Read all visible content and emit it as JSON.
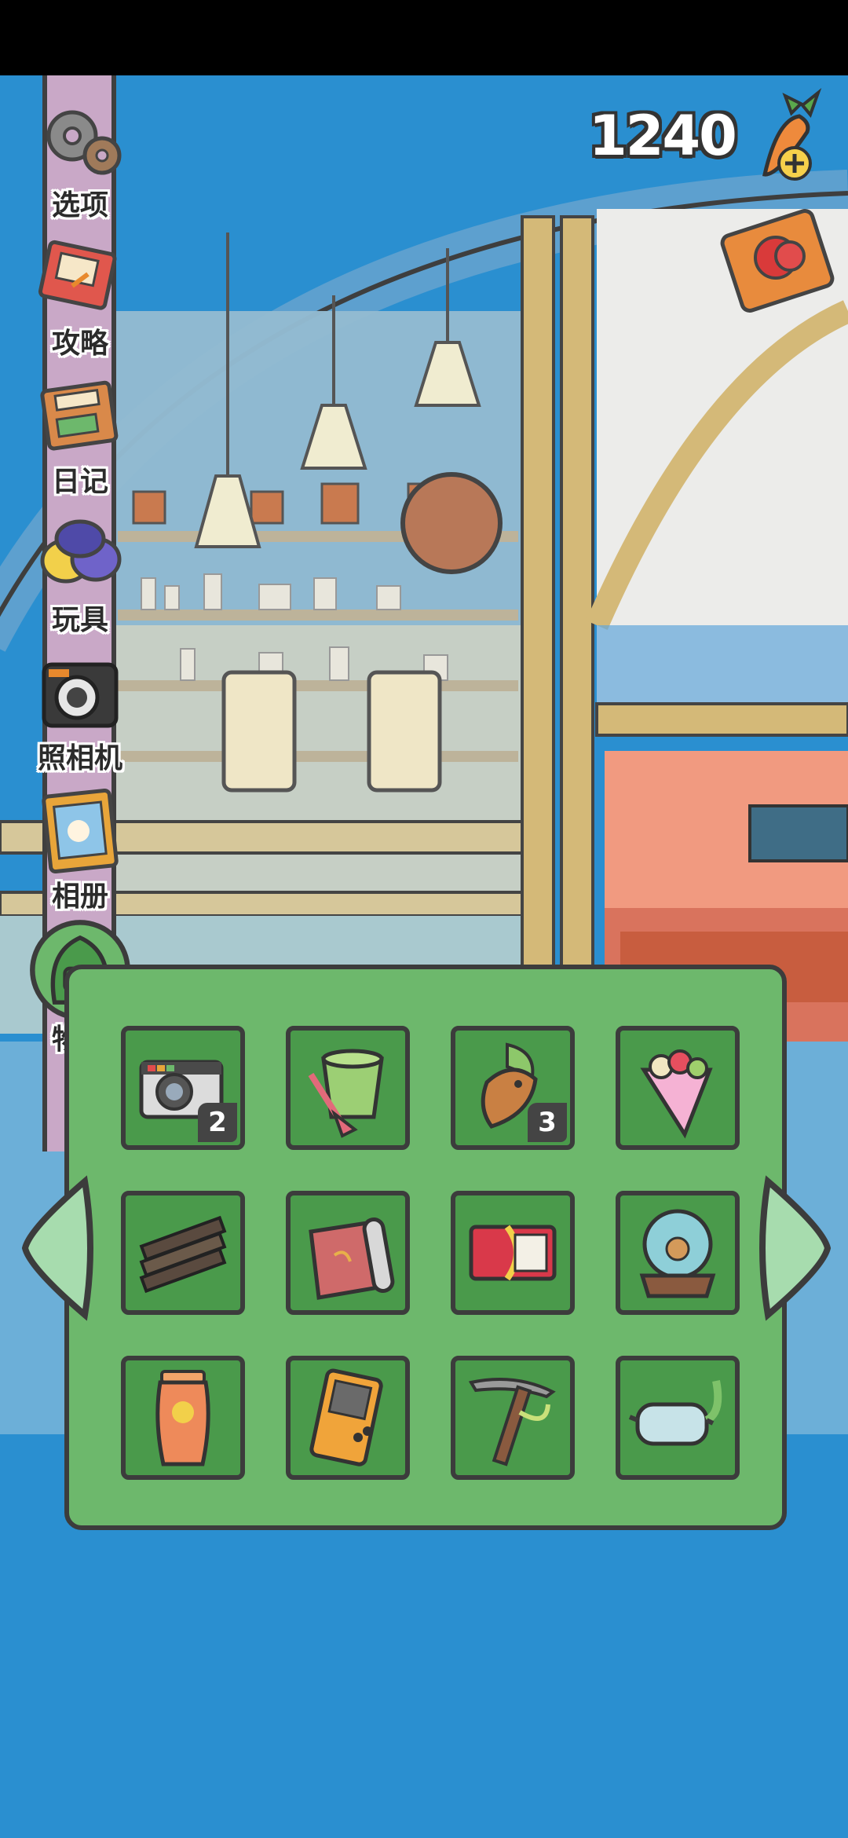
{
  "status_bar": {},
  "header": {
    "currency_value": "1240",
    "currency_icon": "carrot-plus-icon",
    "ticket_icon": "ticket-icon"
  },
  "side_menu": {
    "items": [
      {
        "label": "选项",
        "icon": "gear-icon"
      },
      {
        "label": "攻略",
        "icon": "guidebook-icon"
      },
      {
        "label": "日记",
        "icon": "diary-icon"
      },
      {
        "label": "玩具",
        "icon": "toy-balls-icon"
      },
      {
        "label": "照相机",
        "icon": "camera-icon"
      },
      {
        "label": "相册",
        "icon": "photo-album-icon"
      },
      {
        "label": "物品",
        "icon": "backpack-icon"
      }
    ]
  },
  "inventory": {
    "items": [
      {
        "name": "instant-camera",
        "icon": "instant-camera-icon",
        "count": "2"
      },
      {
        "name": "sand-bucket",
        "icon": "bucket-and-spade-icon",
        "count": ""
      },
      {
        "name": "taiyaki-ice-cream",
        "icon": "taiyaki-icecream-icon",
        "count": "3"
      },
      {
        "name": "crepe",
        "icon": "crepe-icon",
        "count": ""
      },
      {
        "name": "firewood",
        "icon": "firewood-icon",
        "count": ""
      },
      {
        "name": "rolled-rug",
        "icon": "rug-roll-icon",
        "count": ""
      },
      {
        "name": "ticket-card",
        "icon": "ticket-card-icon",
        "count": ""
      },
      {
        "name": "snow-globe",
        "icon": "snow-globe-icon",
        "count": ""
      },
      {
        "name": "sunscreen",
        "icon": "sunscreen-icon",
        "count": ""
      },
      {
        "name": "handheld-game",
        "icon": "handheld-console-icon",
        "count": ""
      },
      {
        "name": "ice-axe",
        "icon": "ice-axe-icon",
        "count": ""
      },
      {
        "name": "snorkel-mask",
        "icon": "snorkel-mask-icon",
        "count": ""
      }
    ],
    "prev_icon": "arrow-left-icon",
    "next_icon": "arrow-right-icon"
  },
  "colors": {
    "panel_green": "#6db86c",
    "slot_green": "#4a9a4b",
    "menu_strip": "#c9a8c7",
    "sea_blue": "#2a8fd0"
  }
}
